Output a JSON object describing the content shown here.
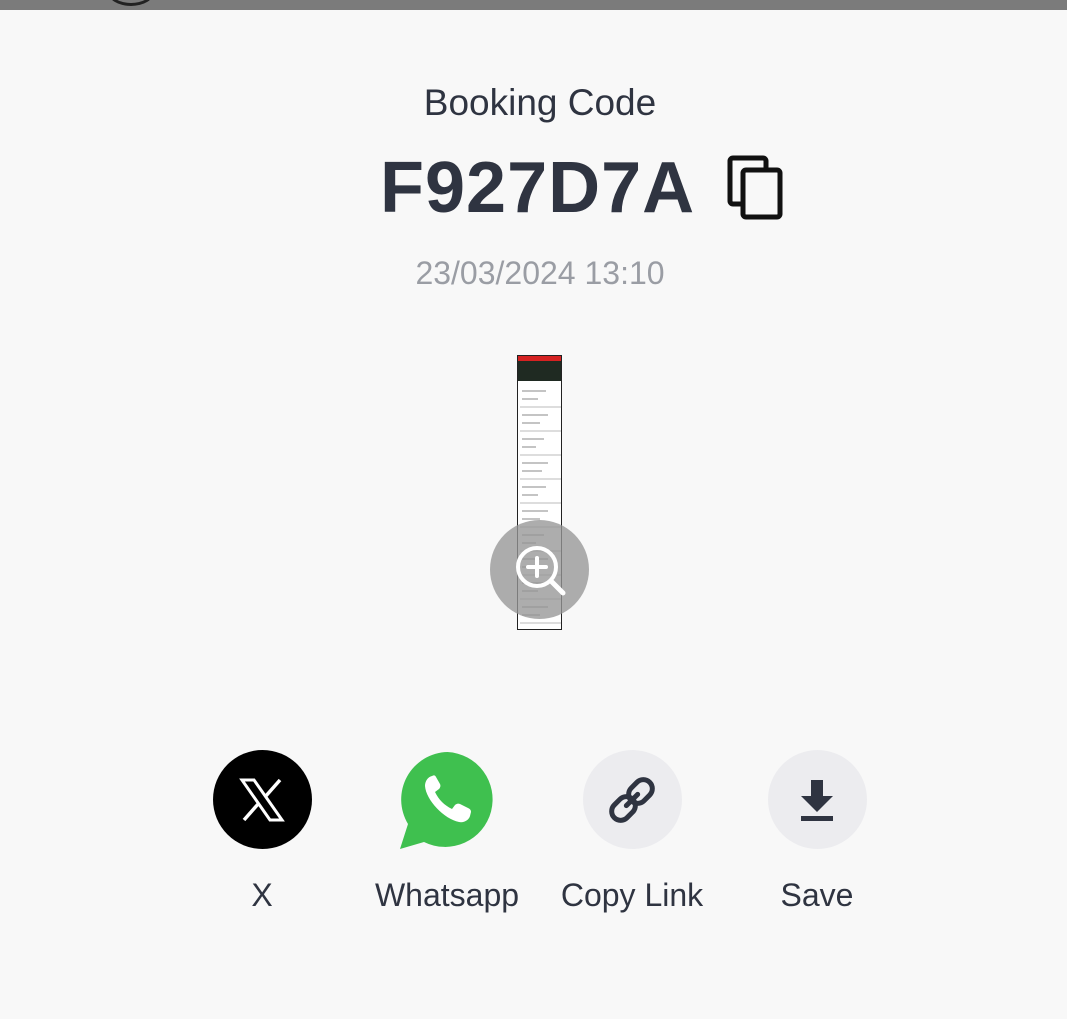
{
  "booking": {
    "label": "Booking Code",
    "code": "F927D7A",
    "datetime": "23/03/2024 13:10"
  },
  "icons": {
    "copy": "copy-icon",
    "zoom": "zoom-in-icon",
    "x": "x-logo-icon",
    "whatsapp": "whatsapp-icon",
    "link": "link-icon",
    "download": "download-icon"
  },
  "share": {
    "items": [
      {
        "label": "X",
        "icon": "x-logo-icon",
        "bg": "#000000"
      },
      {
        "label": "Whatsapp",
        "icon": "whatsapp-icon",
        "bg": "#3fc04f"
      },
      {
        "label": "Copy Link",
        "icon": "link-icon",
        "bg": "#ececef"
      },
      {
        "label": "Save",
        "icon": "download-icon",
        "bg": "#ececef"
      }
    ]
  },
  "colors": {
    "text_primary": "#2f3441",
    "text_secondary": "#9a9da4",
    "whatsapp_green": "#3fc04f",
    "x_black": "#000000",
    "neutral_circle": "#ececef"
  }
}
